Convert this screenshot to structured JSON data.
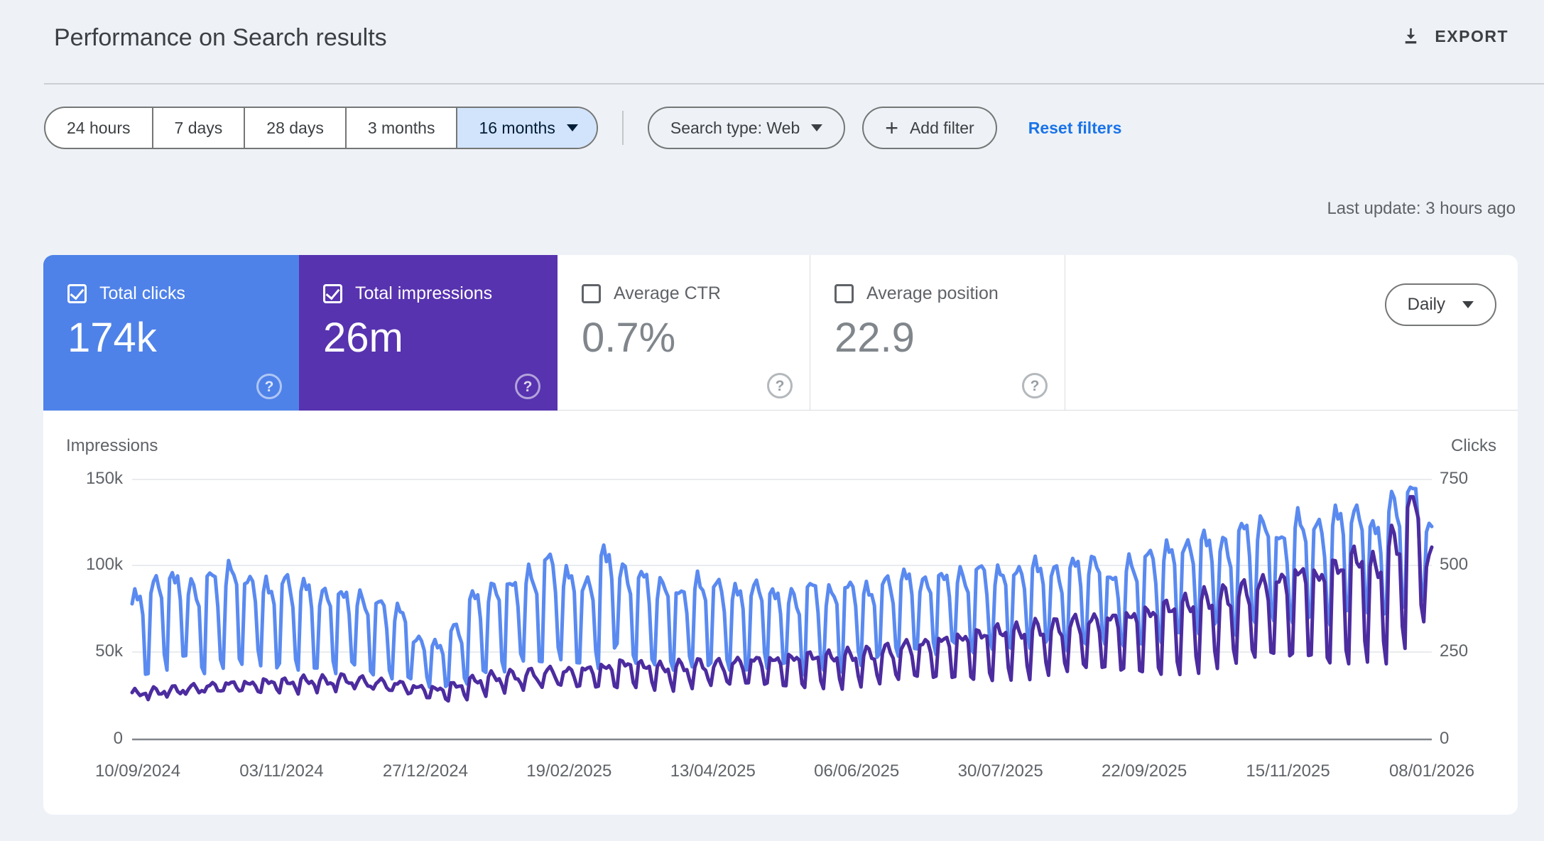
{
  "page": {
    "title": "Performance on Search results",
    "export_label": "EXPORT",
    "last_update": "Last update: 3 hours ago"
  },
  "filters": {
    "date_ranges": [
      "24 hours",
      "7 days",
      "28 days",
      "3 months",
      "16 months"
    ],
    "selected_range": "16 months",
    "search_type_label": "Search type: Web",
    "add_filter_label": "Add filter",
    "reset_label": "Reset filters"
  },
  "metrics": [
    {
      "label": "Total clicks",
      "value": "174k",
      "checked": true,
      "color": "#4f82e8"
    },
    {
      "label": "Total impressions",
      "value": "26m",
      "checked": true,
      "color": "#5733af"
    },
    {
      "label": "Average CTR",
      "value": "0.7%",
      "checked": false,
      "color": "#ffffff"
    },
    {
      "label": "Average position",
      "value": "22.9",
      "checked": false,
      "color": "#ffffff"
    }
  ],
  "granularity": {
    "label": "Daily"
  },
  "icons": {
    "export": "download-icon",
    "dropdown": "caret-down-icon",
    "add_filter": "plus-icon",
    "metric_help": "help-circle-icon",
    "metric_checkbox": "checkbox-icon"
  },
  "colors": {
    "page_background": "#eef2f7",
    "link_blue": "#1a73e8",
    "selected_chip_bg": "#d2e3fc",
    "selected_chip_text": "#001d35",
    "clicks_card": "#4f82e8",
    "impressions_card": "#5733af",
    "clicks_line": "#5a8af0",
    "impressions_line": "#4c2c9f",
    "gridline": "#e9ebee",
    "axis_line": "#80868b"
  },
  "chart_data": {
    "type": "line",
    "title": "Clicks and impressions over time (daily)",
    "granularity": "daily",
    "days": 486,
    "weeks": 70,
    "x_labels": [
      "10/09/2024",
      "03/11/2024",
      "27/12/2024",
      "19/02/2025",
      "13/04/2025",
      "06/06/2025",
      "30/07/2025",
      "22/09/2025",
      "15/11/2025",
      "08/01/2026"
    ],
    "left_axis": {
      "label": "Impressions",
      "ticks": [
        "150k",
        "100k",
        "50k",
        "0"
      ],
      "min": 0,
      "max": 150000
    },
    "right_axis": {
      "label": "Clicks",
      "ticks": [
        "750",
        "500",
        "250",
        "0"
      ],
      "min": 0,
      "max": 750
    },
    "grid": true,
    "legend": "none",
    "series": [
      {
        "name": "Total clicks",
        "axis": "right",
        "color": "#5a8af0",
        "pattern": "strong weekly cycle: weekday peaks, weekend troughs; dip late Dec 2024, steady growth from Oct 2025, spike to ~730 early Jan 2026",
        "weekly_peaks": [
          420,
          470,
          490,
          455,
          480,
          500,
          480,
          460,
          470,
          450,
          435,
          440,
          420,
          400,
          380,
          300,
          285,
          330,
          420,
          450,
          470,
          490,
          530,
          485,
          470,
          560,
          500,
          480,
          460,
          445,
          470,
          455,
          435,
          460,
          440,
          425,
          450,
          435,
          465,
          445,
          465,
          480,
          470,
          490,
          485,
          500,
          490,
          505,
          520,
          495,
          515,
          530,
          485,
          520,
          540,
          560,
          580,
          600,
          575,
          620,
          640,
          605,
          650,
          625,
          660,
          680,
          635,
          700,
          730,
          620
        ],
        "weekly_lows": [
          180,
          200,
          210,
          190,
          205,
          215,
          205,
          195,
          200,
          195,
          190,
          190,
          185,
          175,
          170,
          150,
          145,
          160,
          185,
          195,
          205,
          215,
          230,
          210,
          205,
          240,
          220,
          210,
          200,
          195,
          205,
          200,
          190,
          205,
          195,
          185,
          200,
          190,
          205,
          230,
          240,
          250,
          245,
          255,
          250,
          260,
          255,
          260,
          270,
          255,
          265,
          275,
          250,
          270,
          280,
          295,
          305,
          315,
          300,
          330,
          340,
          320,
          345,
          330,
          355,
          365,
          335,
          380,
          400,
          520
        ]
      },
      {
        "name": "Total impressions",
        "axis": "left",
        "color": "#4c2c9f",
        "pattern": "flat ~26-35k through 2024, slow rise 2025, strong growth Oct-Dec 2025, spike ~135k early Jan 2026; weekend dips deepen over time",
        "weekly_avg_k": [
          26,
          27,
          28,
          29,
          30,
          31,
          31,
          32,
          32,
          33,
          33,
          34,
          33,
          32,
          31,
          29,
          28,
          30,
          33,
          35,
          36,
          37,
          38,
          38,
          39,
          40,
          42,
          41,
          40,
          41,
          42,
          42,
          43,
          44,
          44,
          45,
          46,
          46,
          47,
          48,
          50,
          52,
          53,
          55,
          56,
          58,
          60,
          60,
          62,
          63,
          65,
          66,
          67,
          68,
          70,
          73,
          75,
          78,
          80,
          83,
          86,
          88,
          92,
          90,
          95,
          100,
          96,
          110,
          135,
          100
        ]
      }
    ]
  }
}
